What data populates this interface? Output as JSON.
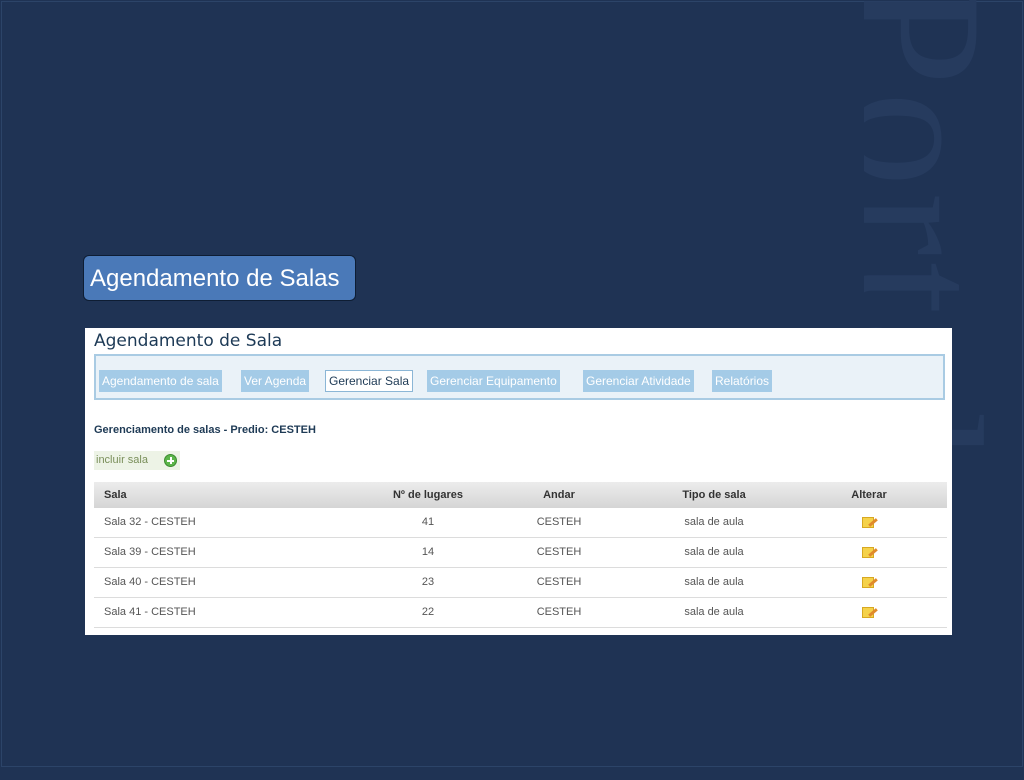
{
  "slide": {
    "title": "Agendamento de Salas",
    "watermark": "Portal"
  },
  "app": {
    "title": "Agendamento de Sala",
    "tabs": [
      {
        "label": "Agendamento de sala",
        "active": false
      },
      {
        "label": "Ver Agenda",
        "active": false
      },
      {
        "label": "Gerenciar Sala",
        "active": true
      },
      {
        "label": "Gerenciar Equipamento",
        "active": false
      },
      {
        "label": "Gerenciar Atividade",
        "active": false
      },
      {
        "label": "Relatórios",
        "active": false
      }
    ],
    "section_title": "Gerenciamento de salas - Predio: CESTEH",
    "include_label": "incluir sala",
    "table": {
      "headers": [
        "Sala",
        "Nº de lugares",
        "Andar",
        "Tipo de sala",
        "Alterar"
      ],
      "rows": [
        {
          "sala": "Sala 32 - CESTEH",
          "lugares": "41",
          "andar": "CESTEH",
          "tipo": "sala de aula"
        },
        {
          "sala": "Sala 39 - CESTEH",
          "lugares": "14",
          "andar": "CESTEH",
          "tipo": "sala de aula"
        },
        {
          "sala": "Sala 40 - CESTEH",
          "lugares": "23",
          "andar": "CESTEH",
          "tipo": "sala de aula"
        },
        {
          "sala": "Sala 41 - CESTEH",
          "lugares": "22",
          "andar": "CESTEH",
          "tipo": "sala de aula"
        }
      ]
    }
  },
  "colors": {
    "background": "#1f3354",
    "title_box": "#4a79b8",
    "tab": "#a4cbe7",
    "tab_bar": "#eaf2f8"
  }
}
